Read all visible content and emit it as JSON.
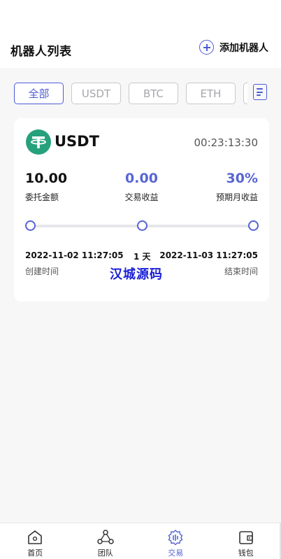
{
  "header": {
    "title": "机器人列表",
    "add_label": "添加机器人",
    "add_icon": "plus-circle-icon"
  },
  "filters": {
    "tabs": [
      "全部",
      "USDT",
      "BTC",
      "ETH"
    ],
    "active_index": 0,
    "menu_icon": "list-menu-icon"
  },
  "robot_card": {
    "coin": "USDT",
    "coin_icon": "tether-icon",
    "runtime": "00:23:13:30",
    "amount": {
      "value": "10.00",
      "label": "委托金额"
    },
    "profit": {
      "value": "0.00",
      "label": "交易收益"
    },
    "expected": {
      "value": "30%",
      "label": "预期月收益"
    },
    "start_time": "2022-11-02 11:27:05",
    "duration": "1 天",
    "end_time": "2022-11-03 11:27:05",
    "start_label": "创建时间",
    "end_label": "结束时间",
    "watermark": "汉城源码"
  },
  "bottom_nav": {
    "items": [
      {
        "label": "首页",
        "icon": "home-icon"
      },
      {
        "label": "团队",
        "icon": "team-icon"
      },
      {
        "label": "交易",
        "icon": "trade-gear-icon"
      },
      {
        "label": "钱包",
        "icon": "wallet-icon"
      }
    ],
    "active_index": 2
  },
  "colors": {
    "accent": "#5563d6",
    "tether_green": "#26a17b",
    "background": "#f7f7f8"
  }
}
